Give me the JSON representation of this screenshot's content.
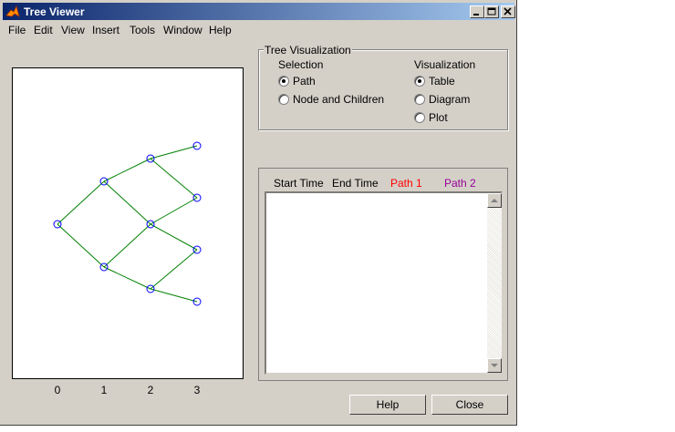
{
  "window": {
    "title": "Tree Viewer"
  },
  "menu": [
    "File",
    "Edit",
    "View",
    "Insert",
    "Tools",
    "Window",
    "Help"
  ],
  "tree_plot": {
    "x_ticks": [
      "0",
      "1",
      "2",
      "3"
    ],
    "node_color": "#0000ff",
    "edge_color": "#008000"
  },
  "tree_visualization": {
    "title": "Tree Visualization",
    "selection_label": "Selection",
    "selection_options": [
      "Path",
      "Node and Children"
    ],
    "selection_value": "Path",
    "visualization_label": "Visualization",
    "visualization_options": [
      "Table",
      "Diagram",
      "Plot"
    ],
    "visualization_value": "Table"
  },
  "table": {
    "columns": [
      {
        "label": "Start Time",
        "color": "#000000"
      },
      {
        "label": "End Time",
        "color": "#000000"
      },
      {
        "label": "Path 1",
        "color": "#ff0000"
      },
      {
        "label": "Path 2",
        "color": "#990099"
      }
    ]
  },
  "buttons": {
    "help": "Help",
    "close": "Close"
  }
}
